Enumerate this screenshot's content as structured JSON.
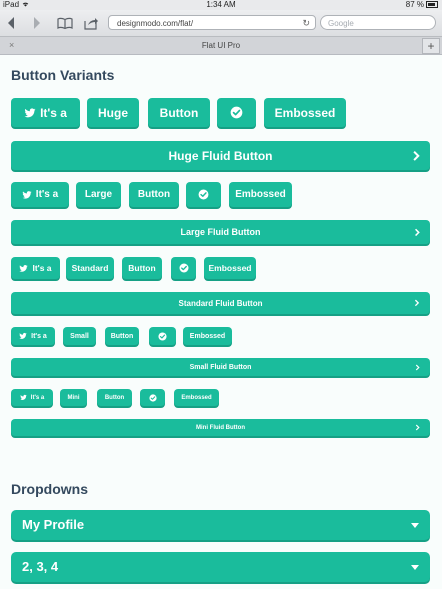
{
  "status": {
    "carrier": "iPad",
    "time": "1:34 AM",
    "battery": "87 %"
  },
  "browser": {
    "url": "designmodo.com/flat/",
    "search_placeholder": "Google",
    "tab_title": "Flat UI Pro",
    "tab_close": "×",
    "tab_add": "+"
  },
  "button_variants": {
    "heading": "Button Variants",
    "rows": [
      {
        "size": "huge",
        "tweet": "It's a",
        "size_label": "Huge",
        "button": "Button",
        "embossed": "Embossed",
        "fluid": "Huge Fluid Button"
      },
      {
        "size": "large",
        "tweet": "It's a",
        "size_label": "Large",
        "button": "Button",
        "embossed": "Embossed",
        "fluid": "Large Fluid Button"
      },
      {
        "size": "standard",
        "tweet": "It's a",
        "size_label": "Standard",
        "button": "Button",
        "embossed": "Embossed",
        "fluid": "Standard Fluid Button"
      },
      {
        "size": "small",
        "tweet": "It's a",
        "size_label": "Small",
        "button": "Button",
        "embossed": "Embossed",
        "fluid": "Small Fluid Button"
      },
      {
        "size": "mini",
        "tweet": "It's a",
        "size_label": "Mini",
        "button": "Button",
        "embossed": "Embossed",
        "fluid": "Mini Fluid Button"
      }
    ]
  },
  "dropdowns": {
    "heading": "Dropdowns",
    "items": [
      {
        "label": "My Profile"
      },
      {
        "label": "2, 3, 4"
      }
    ]
  },
  "colors": {
    "accent": "#1abc9c",
    "accent_dark": "#16a085",
    "heading": "#34495e"
  }
}
